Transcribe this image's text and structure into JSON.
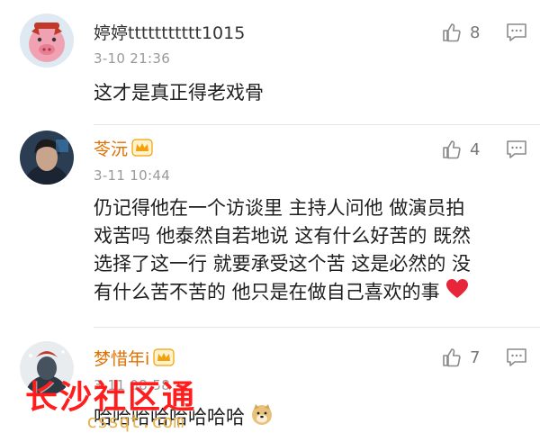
{
  "comments": [
    {
      "username": "婷婷ttttttttttt1015",
      "time": "3-10 21:36",
      "text": "这才是真正得老戏骨",
      "likes": "8",
      "verified_crown": false
    },
    {
      "username": "苓沅",
      "time": "3-11 10:44",
      "text_lines": [
        "仍记得他在一个访谈里 主持人问他 做演员拍",
        "戏苦吗 他泰然自若地说 这有什么好苦的 既然",
        "选择了这一行 就要承受这个苦 这是必然的 没",
        "有什么苦不苦的 他只是在做自己喜欢的事"
      ],
      "emoji": "heart",
      "likes": "4",
      "verified_crown": true
    },
    {
      "username": "梦惜年i",
      "time": "3-11 08:58",
      "text": "哈哈哈哈哈哈哈哈",
      "emoji": "doge",
      "likes": "7",
      "verified_crown": true
    }
  ],
  "watermark": {
    "text": "长沙社区通",
    "url": "cssqt.com"
  },
  "colors": {
    "username_vip": "#e07000",
    "time": "#999999",
    "icon": "#8a8a8a"
  }
}
